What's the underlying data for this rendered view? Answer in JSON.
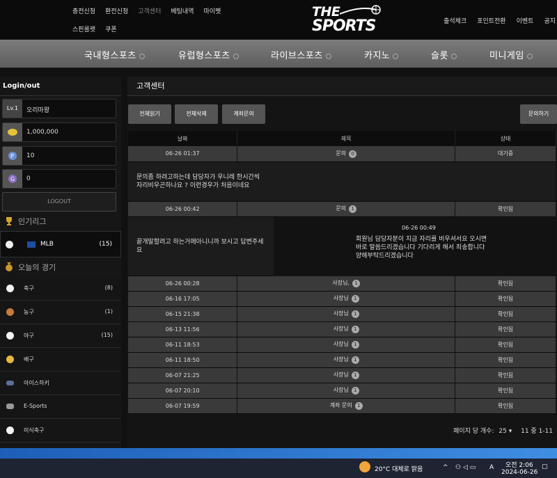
{
  "top_links": [
    "충전신청",
    "환전신청",
    "고객센터",
    "베팅내역",
    "마이펫",
    "스핀룰렛",
    "쿠폰"
  ],
  "logo": {
    "line1": "THE",
    "line2": "SPORTS"
  },
  "right_links": [
    "출석체크",
    "포인트전환",
    "이벤트",
    "공지"
  ],
  "main_nav": [
    "국내형스포츠",
    "유럽형스포츠",
    "라이브스포츠",
    "카지노",
    "슬롯",
    "미니게임"
  ],
  "sidebar": {
    "title": "Login/out",
    "level": "Lv.1",
    "nickname": "오리마왕",
    "money": "1,000,000",
    "point": "10",
    "gcoin": "0",
    "logout_label": "LOGOUT",
    "popular_header": "인기리그",
    "league": {
      "name": "MLB",
      "count": "(15)"
    },
    "today_header": "오늘의 경기",
    "sports": [
      {
        "name": "축구",
        "count": "(8)",
        "color": "#f2f2f2"
      },
      {
        "name": "농구",
        "count": "(1)",
        "color": "#c87a3a"
      },
      {
        "name": "야구",
        "count": "(15)",
        "color": "#f2f2f2"
      },
      {
        "name": "배구",
        "count": "",
        "color": "#e6b93c"
      },
      {
        "name": "아이스하키",
        "count": "",
        "color": "#5a6f9a"
      },
      {
        "name": "E-Sports",
        "count": "",
        "color": "#999999"
      },
      {
        "name": "미식축구",
        "count": "",
        "color": "#f2f2f2"
      }
    ]
  },
  "content": {
    "title": "고객센터",
    "buttons": {
      "read_all": "전체읽기",
      "delete_all": "전체삭제",
      "account_inquiry": "계좌문의",
      "inquire": "문의하기"
    },
    "columns": [
      "날짜",
      "제목",
      "상태"
    ],
    "rows": [
      {
        "date": "06-26 01:37",
        "subject": "문의",
        "badge": "0",
        "status": "대기중",
        "question": "문의좀 하려고하는데 담당자가 우니레 한시간씩 자리비우곤하나요 ? 이런경우가 처음이네요"
      },
      {
        "date": "06-26 00:42",
        "subject": "문의",
        "badge": "1",
        "status": "확인됨",
        "question": "끝개말할려고 하는거에아니니까 보시고 답변주세요",
        "answer_time": "06-26 00:49",
        "answer": "회원님 담당자분이 지금 자리를 비우셔서요 오시면 바로 말씀드리겠습니다 기다리게 해서 죄송합니다 양해부탁드리겠습니다"
      },
      {
        "date": "06-26 00:28",
        "subject": "사장님,",
        "badge": "1",
        "status": "확인됨"
      },
      {
        "date": "06-16 17:05",
        "subject": "사장님",
        "badge": "1",
        "status": "확인됨"
      },
      {
        "date": "06-15 21:38",
        "subject": "사장님",
        "badge": "1",
        "status": "확인됨"
      },
      {
        "date": "06-13 11:56",
        "subject": "사장님",
        "badge": "1",
        "status": "확인됨"
      },
      {
        "date": "06-11 18:53",
        "subject": "사장님",
        "badge": "1",
        "status": "확인됨"
      },
      {
        "date": "06-11 18:50",
        "subject": "사장님",
        "badge": "1",
        "status": "확인됨"
      },
      {
        "date": "06-07 21:25",
        "subject": "사장님",
        "badge": "1",
        "status": "확인됨"
      },
      {
        "date": "06-07 20:10",
        "subject": "사장님",
        "badge": "1",
        "status": "확인됨"
      },
      {
        "date": "06-07 19:59",
        "subject": "계좌 문의",
        "badge": "1",
        "status": "확인됨"
      }
    ],
    "pager": {
      "label": "페이지 당 개수:",
      "per_page": "25",
      "range": "11 중 1-11"
    }
  },
  "taskbar": {
    "weather": "20°C 대체로 맑음",
    "time": "오전 2:06",
    "date": "2024-06-26",
    "lang": "A"
  }
}
